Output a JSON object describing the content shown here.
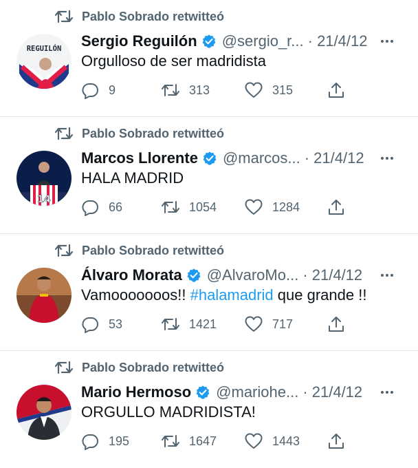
{
  "tweets": [
    {
      "retweeted_by": "Pablo Sobrado retwitteó",
      "name": "Sergio Reguilón",
      "handle": "@sergio_r...",
      "date": "· 21/4/12",
      "text": "Orgulloso de ser madridista",
      "hashtag": "",
      "text_after": "",
      "replies": "9",
      "retweets": "313",
      "likes": "315",
      "avatar_text": "REGUILÓN"
    },
    {
      "retweeted_by": "Pablo Sobrado retwitteó",
      "name": "Marcos Llorente",
      "handle": "@marcos...",
      "date": "· 21/4/12",
      "text": "HALA MADRID",
      "hashtag": "",
      "text_after": "",
      "replies": "66",
      "retweets": "1054",
      "likes": "1284",
      "avatar_text": "14"
    },
    {
      "retweeted_by": "Pablo Sobrado retwitteó",
      "name": "Álvaro Morata",
      "handle": "@AlvaroMo...",
      "date": "· 21/4/12",
      "text": "Vamooooooos!! ",
      "hashtag": "#halamadrid",
      "text_after": " que grande !!",
      "replies": "53",
      "retweets": "1421",
      "likes": "717",
      "avatar_text": ""
    },
    {
      "retweeted_by": "Pablo Sobrado retwitteó",
      "name": "Mario Hermoso",
      "handle": "@mariohe...",
      "date": "· 21/4/12",
      "text": "ORGULLO MADRIDISTA!",
      "hashtag": "",
      "text_after": "",
      "replies": "195",
      "retweets": "1647",
      "likes": "1443",
      "avatar_text": ""
    }
  ],
  "colors": {
    "verified": "#1d9bf0",
    "secondary_text": "#536471",
    "hashtag": "#1d9bf0",
    "divider": "#e1e6ea"
  },
  "icons": [
    "retweet-icon",
    "verified-badge-icon",
    "more-icon",
    "reply-icon",
    "like-icon",
    "share-icon"
  ]
}
